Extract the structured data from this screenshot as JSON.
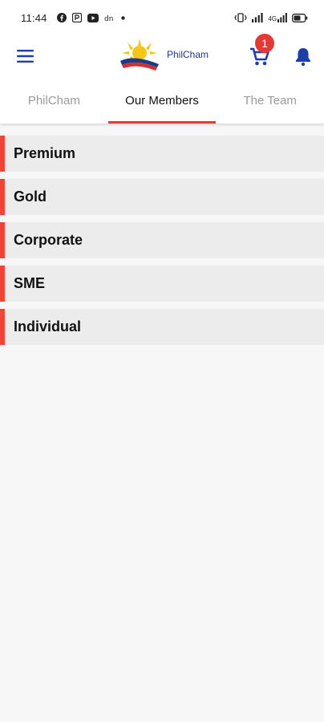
{
  "status_bar": {
    "time": "11:44",
    "left_icons": [
      "facebook-icon",
      "p-icon",
      "youtube-icon",
      "d-icon",
      "dot-icon"
    ],
    "right_icons": [
      "vibrate-icon",
      "signal-icon",
      "wifi-data-icon",
      "battery-icon"
    ],
    "data_label": "4G"
  },
  "app_bar": {
    "logo_text": "PhilCham",
    "cart_count": "1",
    "colors": {
      "brand_blue": "#1f3a8a",
      "badge_red": "#e53935",
      "bell_blue": "#1e3fa8"
    }
  },
  "tabs": [
    {
      "label": "PhilCham",
      "active": false
    },
    {
      "label": "Our Members",
      "active": true
    },
    {
      "label": "The Team",
      "active": false
    }
  ],
  "members": [
    {
      "label": "Premium"
    },
    {
      "label": "Gold"
    },
    {
      "label": "Corporate"
    },
    {
      "label": "SME"
    },
    {
      "label": "Individual"
    }
  ],
  "accent_color": "#f04438"
}
